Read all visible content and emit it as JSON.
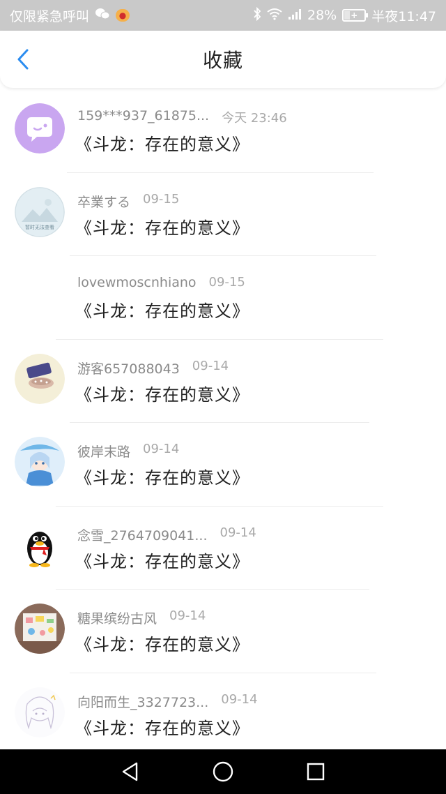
{
  "status_bar": {
    "carrier": "仅限紧急呼叫",
    "battery_percent": "28%",
    "battery_level": 0.28,
    "time": "半夜11:47"
  },
  "header": {
    "title": "收藏"
  },
  "items": [
    {
      "name": "159***937_61875...",
      "time": "今天 23:46",
      "work": "《斗龙：存在的意义》",
      "avatar": "chat-bubble"
    },
    {
      "name": "卒業する",
      "time": "09-15",
      "work": "《斗龙：存在的意义》",
      "avatar": "placeholder-image"
    },
    {
      "name": "lovewmoscnhiano",
      "time": "09-15",
      "work": "《斗龙：存在的意义》",
      "avatar": "none"
    },
    {
      "name": "游客657088043",
      "time": "09-14",
      "work": "《斗龙：存在的意义》",
      "avatar": "photo-cake"
    },
    {
      "name": "彼岸末路",
      "time": "09-14",
      "work": "《斗龙：存在的意义》",
      "avatar": "anime-girl"
    },
    {
      "name": "念雪_2764709041...",
      "time": "09-14",
      "work": "《斗龙：存在的意义》",
      "avatar": "qq-penguin"
    },
    {
      "name": "糖果缤纷古风",
      "time": "09-14",
      "work": "《斗龙：存在的意义》",
      "avatar": "photo-painting"
    },
    {
      "name": "向阳而生_3327723...",
      "time": "09-14",
      "work": "《斗龙：存在的意义》",
      "avatar": "sketch-girl"
    }
  ],
  "avatar_placeholder_text": "暂时无法查看",
  "colors": {
    "accent": "#2a8cf0",
    "status_bar_bg": "#c9c9c9",
    "chat_avatar_bg": "#c9a6f0"
  },
  "icons": {
    "back": "chevron-left-icon",
    "nav_back": "triangle-back-icon",
    "nav_home": "circle-home-icon",
    "nav_recent": "square-recent-icon"
  }
}
